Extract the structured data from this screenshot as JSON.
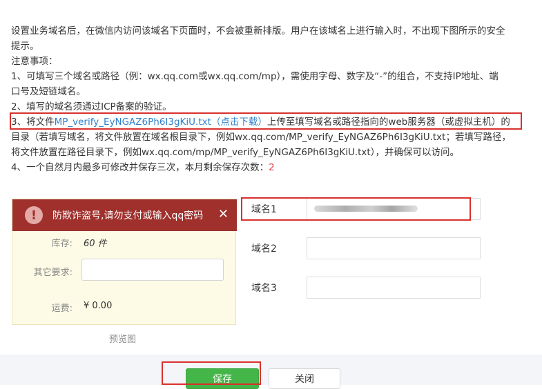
{
  "notes": {
    "intro": "设置业务域名后，在微信内访问该域名下页面时，不会被重新排版。用户在该域名上进行输入时，不出现下图所示的安全",
    "intro2": "提示。",
    "heading": "注意事项：",
    "item1a": "1、可填写三个域名或路径（例：wx.qq.com或wx.qq.com/mp），需使用字母、数字及“-”的组合，不支持IP地址、端",
    "item1b": "口号及短链域名。",
    "item2": "2、填写的域名须通过ICP备案的验证。",
    "item3_prefix": "3、将文件",
    "item3_link": "MP_verify_EyNGAZ6Ph6I3gKiU.txt（点击下载）",
    "item3_suffix": "上传至填写域名或路径指向的web服务器（或虚拟主机）的",
    "item3b": "目录（若填写域名，将文件放置在域名根目录下，例如wx.qq.com/MP_verify_EyNGAZ6Ph6I3gKiU.txt；若填写路径，",
    "item3c": "将文件放置在路径目录下，例如wx.qq.com/mp/MP_verify_EyNGAZ6Ph6I3gKiU.txt），并确保可以访问。",
    "item4_prefix": "4、一个自然月内最多可修改并保存三次，本月剩余保存次数：",
    "item4_count": "2"
  },
  "preview": {
    "warning_icon": "!",
    "warning_text": "防欺诈盗号,请勿支付或输入qq密码",
    "close_icon": "✕",
    "stock_label": "库存:",
    "stock_value": "60 件",
    "other_label": "其它要求:",
    "shipping_label": "运费:",
    "shipping_value": "¥ 0.00",
    "caption": "预览图"
  },
  "domains": {
    "label1": "域名1",
    "label2": "域名2",
    "label3": "域名3",
    "value2": "",
    "value3": ""
  },
  "footer": {
    "save_label": "保存",
    "close_label": "关闭"
  },
  "colors": {
    "link": "#2f80c9",
    "count": "#e64340",
    "warning_bg": "#9f302c",
    "save_bg": "#44b549",
    "highlight_box": "#d9302c"
  }
}
